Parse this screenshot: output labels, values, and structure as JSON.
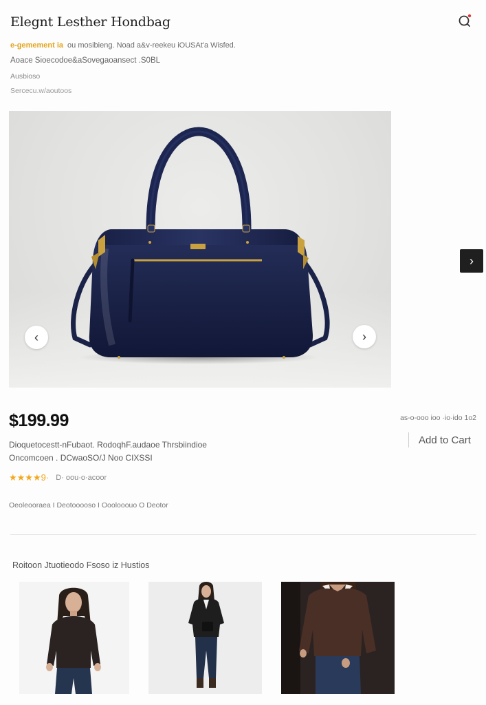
{
  "header": {
    "title": "Elegnt Lesther Hondbag",
    "cart_icon": "cart-icon"
  },
  "meta": {
    "line1_highlight": "e-gemement ia",
    "line1_rest": "ou mosibieng. Noad a&v-reekeu iOUSAt'a Wisfed.",
    "line2": "Aoace Sioecodoe&aSovegaoansect .S0BL",
    "line3": "Ausbioso",
    "line4": "Sercecu.w/aoutoos"
  },
  "gallery": {
    "prev_icon": "chevron-left-icon",
    "next_icon": "chevron-right-icon",
    "prev_glyph": "‹",
    "next_glyph": "›",
    "side_next_glyph": "›",
    "bag_color": "#1b2348",
    "hardware_color": "#c9a23f"
  },
  "product": {
    "price": "$199.99",
    "stock_note": "as-o-ooo ioo ·io·ido 1o2",
    "add_to_cart": "Add to Cart",
    "desc_line1": "Dioquetocestt-nFubaot. RodoqhF.audaoe Thrsbiindioe",
    "desc_line2": "Oncomcoen . DCwaoSO/J Noo CIXSSI",
    "stars": "★★★★",
    "star_partial": "9·",
    "rating_text": "D· oou·o·acoor",
    "tags": "Oeoleooraea   I   Deotooooso   I   Ooolooouo   O   Deotor"
  },
  "related": {
    "title": "Roitoon Jtuotieodo Fsoso iz Hustios",
    "items": [
      {
        "label": "related-item-1"
      },
      {
        "label": "related-item-2"
      },
      {
        "label": "related-item-3"
      }
    ]
  }
}
